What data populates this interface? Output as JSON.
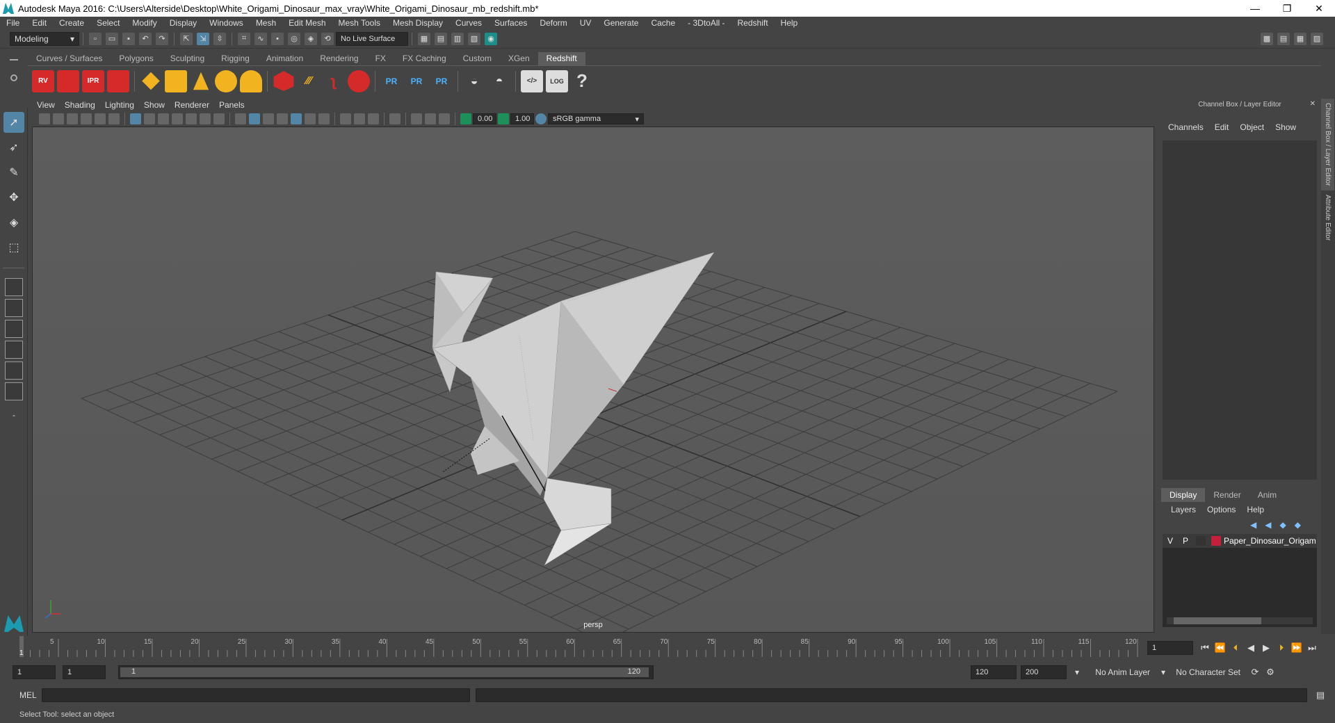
{
  "window": {
    "title": "Autodesk Maya 2016: C:\\Users\\Alterside\\Desktop\\White_Origami_Dinosaur_max_vray\\White_Origami_Dinosaur_mb_redshift.mb*",
    "minimize": "—",
    "restore": "❐",
    "close": "✕"
  },
  "menubar": [
    "File",
    "Edit",
    "Create",
    "Select",
    "Modify",
    "Display",
    "Windows",
    "Mesh",
    "Edit Mesh",
    "Mesh Tools",
    "Mesh Display",
    "Curves",
    "Surfaces",
    "Deform",
    "UV",
    "Generate",
    "Cache",
    "- 3DtoAll -",
    "Redshift",
    "Help"
  ],
  "toolbar": {
    "mode": "Modeling",
    "live_surface": "No Live Surface"
  },
  "shelf": {
    "tabs": [
      "Curves / Surfaces",
      "Polygons",
      "Sculpting",
      "Rigging",
      "Animation",
      "Rendering",
      "FX",
      "FX Caching",
      "Custom",
      "XGen",
      "Redshift"
    ],
    "active_tab": "Redshift",
    "red_icons": [
      "RV",
      "",
      "IPR",
      ""
    ],
    "pr_icons": [
      "PR",
      "PR",
      "PR"
    ],
    "log_label": "LOG",
    "help_icon": "?"
  },
  "viewport": {
    "menu": [
      "View",
      "Shading",
      "Lighting",
      "Show",
      "Renderer",
      "Panels"
    ],
    "exposure": "0.00",
    "gamma": "1.00",
    "colorspace": "sRGB gamma",
    "camera": "persp"
  },
  "right_panel": {
    "title": "Channel Box / Layer Editor",
    "tabs": [
      "Channels",
      "Edit",
      "Object",
      "Show"
    ],
    "layer_tabs": [
      "Display",
      "Render",
      "Anim"
    ],
    "active_layer_tab": "Display",
    "layer_menu": [
      "Layers",
      "Options",
      "Help"
    ],
    "layer": {
      "v": "V",
      "p": "P",
      "name": "Paper_Dinosaur_Origam",
      "color": "#c4203a"
    },
    "side_tabs": [
      "Channel Box / Layer Editor",
      "Attribute Editor"
    ]
  },
  "timeline": {
    "ticks": [
      "5",
      "10",
      "15",
      "20",
      "25",
      "30",
      "35",
      "40",
      "45",
      "50",
      "55",
      "60",
      "65",
      "70",
      "75",
      "80",
      "85",
      "90",
      "95",
      "100",
      "105",
      "110",
      "115",
      "120"
    ],
    "start_tick": "1",
    "current_frame": "1"
  },
  "range": {
    "start": "1",
    "inner_start": "1",
    "slider_start": "1",
    "slider_end": "120",
    "end": "120",
    "max": "200",
    "anim_layer": "No Anim Layer",
    "char_set": "No Character Set"
  },
  "cmdline": {
    "label": "MEL"
  },
  "help_line": "Select Tool: select an object"
}
